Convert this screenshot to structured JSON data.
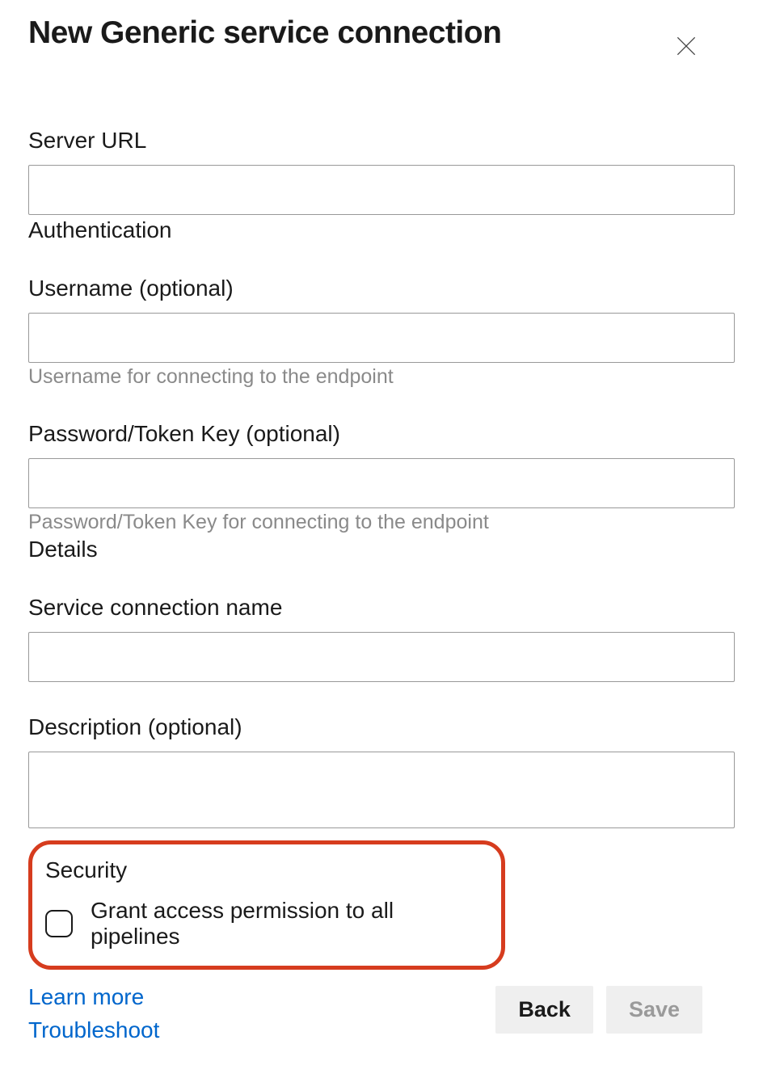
{
  "header": {
    "title": "New Generic service connection"
  },
  "fields": {
    "server_url": {
      "label": "Server URL",
      "value": ""
    },
    "auth_section": "Authentication",
    "username": {
      "label": "Username (optional)",
      "value": "",
      "helper": "Username for connecting to the endpoint"
    },
    "password": {
      "label": "Password/Token Key (optional)",
      "value": "",
      "helper": "Password/Token Key for connecting to the endpoint"
    },
    "details_section": "Details",
    "connection_name": {
      "label": "Service connection name",
      "value": ""
    },
    "description": {
      "label": "Description (optional)",
      "value": ""
    }
  },
  "security": {
    "heading": "Security",
    "checkbox_label": "Grant access permission to all pipelines",
    "checked": false
  },
  "footer": {
    "learn_more": "Learn more",
    "troubleshoot": "Troubleshoot",
    "back": "Back",
    "save": "Save"
  }
}
